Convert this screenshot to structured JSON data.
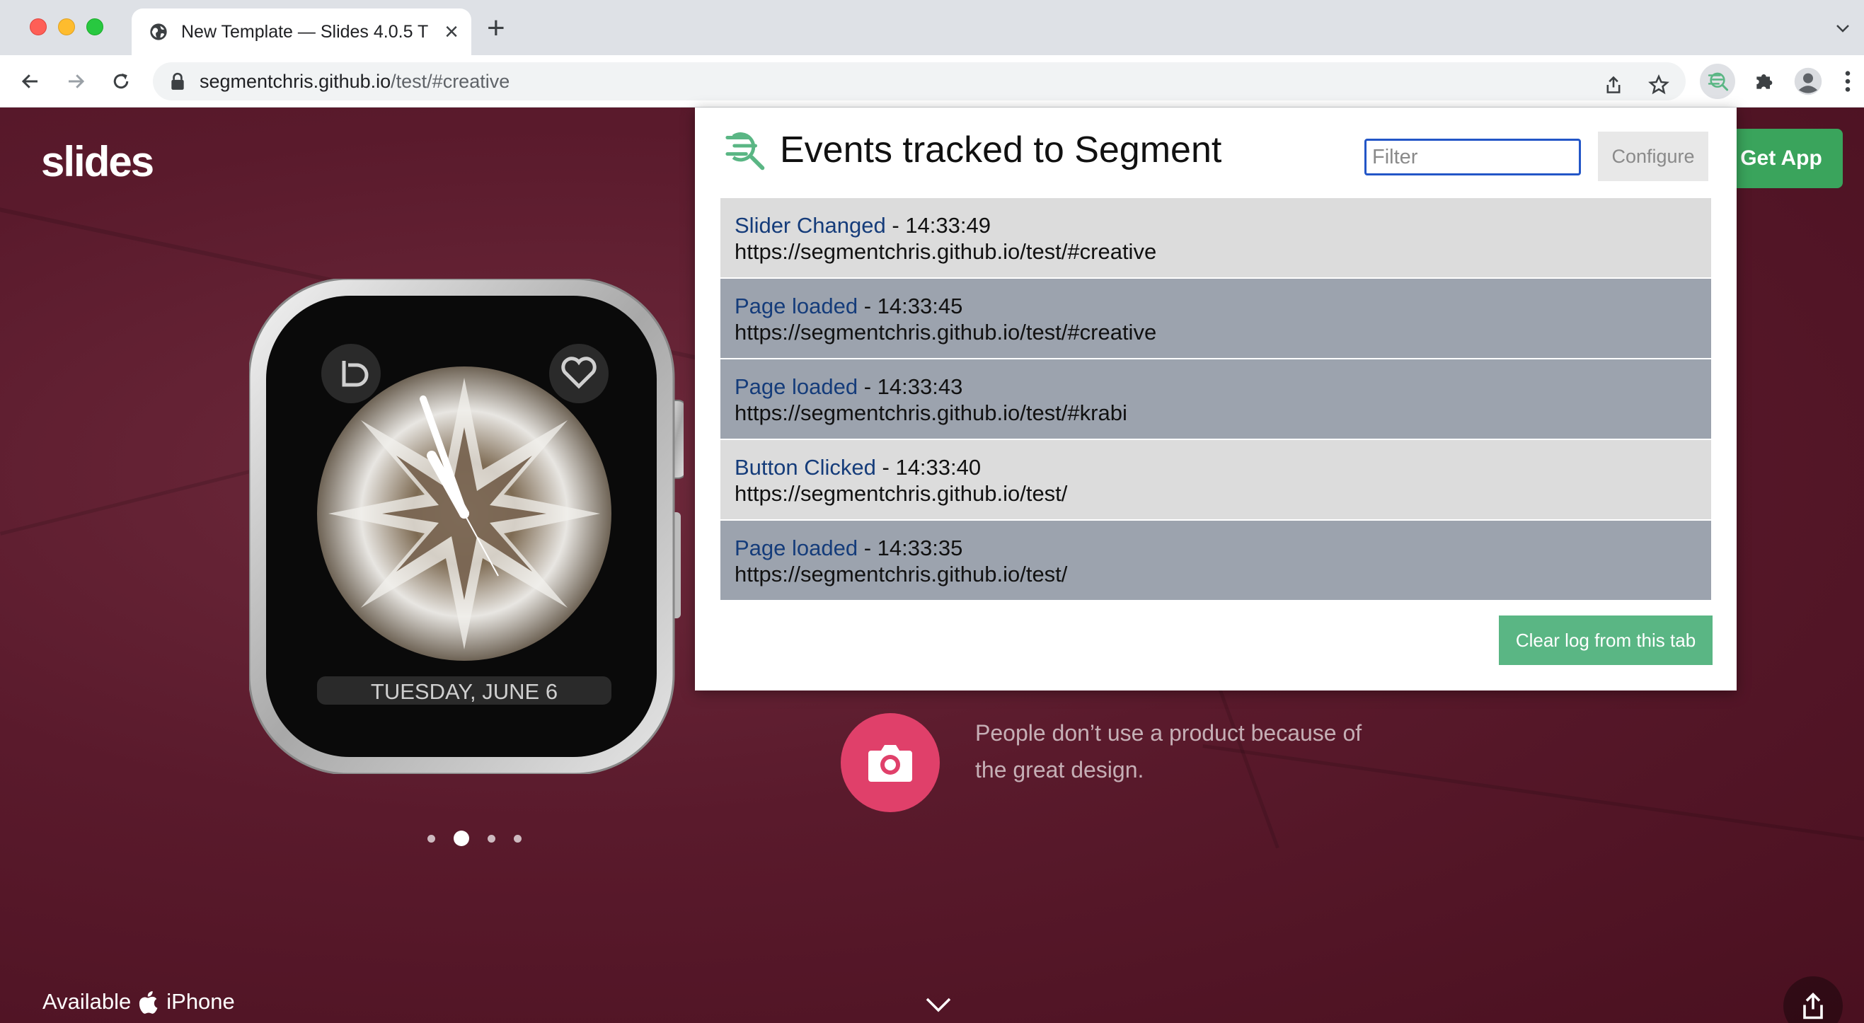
{
  "browser": {
    "tab_title": "New Template — Slides 4.0.5 T",
    "new_tab_label": "+",
    "url_host": "segmentchris.github.io",
    "url_path": "/test/#creative"
  },
  "page": {
    "brand": "slides",
    "get_app_label": "Get App",
    "watch_date": "TUESDAY, JUNE 6",
    "feature_text": "People don’t use a product because of the great design.",
    "available_prefix": "Available",
    "available_suffix": "iPhone",
    "slider": {
      "count": 4,
      "active_index": 1
    }
  },
  "popup": {
    "title": "Events tracked to Segment",
    "filter_placeholder": "Filter",
    "configure_label": "Configure",
    "clear_label": "Clear log from this tab",
    "events": [
      {
        "name": "Slider Changed",
        "time": "14:33:49",
        "url": "https://segmentchris.github.io/test/#creative",
        "shade": "light"
      },
      {
        "name": "Page loaded",
        "time": "14:33:45",
        "url": "https://segmentchris.github.io/test/#creative",
        "shade": "dark"
      },
      {
        "name": "Page loaded",
        "time": "14:33:43",
        "url": "https://segmentchris.github.io/test/#krabi",
        "shade": "dark"
      },
      {
        "name": "Button Clicked",
        "time": "14:33:40",
        "url": "https://segmentchris.github.io/test/",
        "shade": "light"
      },
      {
        "name": "Page loaded",
        "time": "14:33:35",
        "url": "https://segmentchris.github.io/test/",
        "shade": "dark"
      }
    ]
  },
  "colors": {
    "accent_green": "#5ab684",
    "event_name_blue": "#153c7a",
    "page_bg": "#5a1a2c",
    "camera_pink": "#e0406a"
  },
  "icons": [
    "globe-icon",
    "close-icon",
    "back-icon",
    "forward-icon",
    "reload-icon",
    "lock-icon",
    "share-icon",
    "star-icon",
    "segment-extension-icon",
    "puzzle-icon",
    "profile-icon",
    "kebab-menu-icon",
    "camera-icon",
    "apple-icon",
    "chevron-down-icon"
  ]
}
